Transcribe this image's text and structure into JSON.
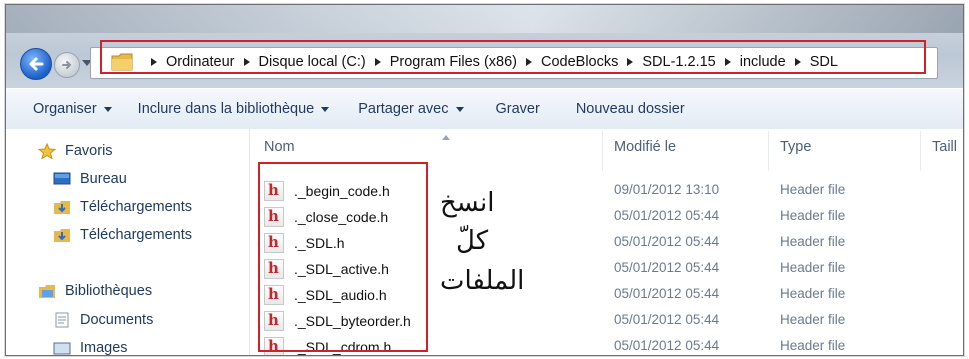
{
  "breadcrumb": [
    "Ordinateur",
    "Disque local (C:)",
    "Program Files (x86)",
    "CodeBlocks",
    "SDL-1.2.15",
    "include",
    "SDL"
  ],
  "toolbar": {
    "organize": "Organiser",
    "include_library": "Inclure dans la bibliothèque",
    "share": "Partager avec",
    "burn": "Graver",
    "new_folder": "Nouveau dossier"
  },
  "sidebar": {
    "favorites_label": "Favoris",
    "favorites": [
      "Bureau",
      "Téléchargements",
      "Téléchargements"
    ],
    "libraries_label": "Bibliothèques",
    "libraries": [
      "Documents",
      "Images"
    ]
  },
  "columns": {
    "name": "Nom",
    "modified": "Modifié le",
    "type": "Type",
    "size": "Taill"
  },
  "files": [
    {
      "name": "._begin_code.h",
      "modified": "09/01/2012 13:10",
      "type": "Header file"
    },
    {
      "name": "._close_code.h",
      "modified": "05/01/2012 05:44",
      "type": "Header file"
    },
    {
      "name": "._SDL.h",
      "modified": "05/01/2012 05:44",
      "type": "Header file"
    },
    {
      "name": "._SDL_active.h",
      "modified": "05/01/2012 05:44",
      "type": "Header file"
    },
    {
      "name": "._SDL_audio.h",
      "modified": "05/01/2012 05:44",
      "type": "Header file"
    },
    {
      "name": "._SDL_byteorder.h",
      "modified": "05/01/2012 05:44",
      "type": "Header file"
    },
    {
      "name": "._SDL_cdrom.h",
      "modified": "05/01/2012 05:44",
      "type": "Header file"
    }
  ],
  "annotation": {
    "line1": "انسخ",
    "line2": "كلّ",
    "line3": "الملفات"
  },
  "icons": {
    "back": "back-arrow-icon",
    "forward": "forward-arrow-icon",
    "folder": "folder-icon",
    "star": "star-icon",
    "desktop": "desktop-icon",
    "downloads": "downloads-folder-icon",
    "library": "library-icon",
    "document": "document-icon",
    "header_file": "header-file-icon"
  },
  "colors": {
    "highlight": "#d0202a",
    "link_text": "#1e3a5f"
  }
}
